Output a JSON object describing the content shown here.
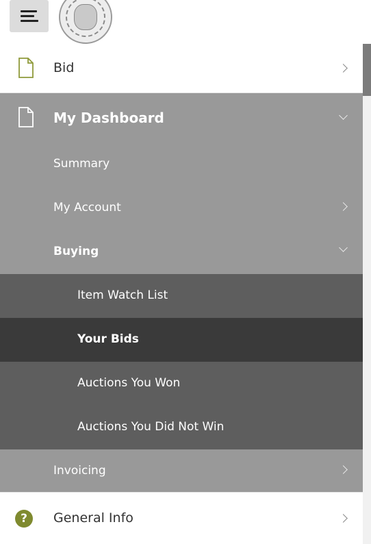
{
  "header": {
    "menu_icon": "hamburger-icon",
    "logo": "state-seal-logo"
  },
  "nav": {
    "bid": {
      "label": "Bid",
      "icon": "document-icon",
      "chevron": "chevron-right-icon"
    },
    "dashboard": {
      "label": "My Dashboard",
      "icon": "document-icon",
      "chevron": "chevron-down-icon",
      "items": {
        "summary": {
          "label": "Summary"
        },
        "my_account": {
          "label": "My Account",
          "chevron": "chevron-right-icon"
        },
        "buying": {
          "label": "Buying",
          "chevron": "chevron-down-icon",
          "items": [
            {
              "label": "Item Watch List",
              "active": false
            },
            {
              "label": "Your Bids",
              "active": true
            },
            {
              "label": "Auctions You Won",
              "active": false
            },
            {
              "label": "Auctions You Did Not Win",
              "active": false
            }
          ]
        },
        "invoicing": {
          "label": "Invoicing",
          "chevron": "chevron-right-icon"
        }
      }
    },
    "general_info": {
      "label": "General Info",
      "icon": "help-icon",
      "icon_glyph": "?",
      "chevron": "chevron-right-icon"
    }
  },
  "colors": {
    "accent": "#94a23a",
    "section_bg": "#999999",
    "sub_bg": "#5e5e5e",
    "active_bg": "#3a3a3a",
    "help_icon": "#7f8a2f"
  }
}
